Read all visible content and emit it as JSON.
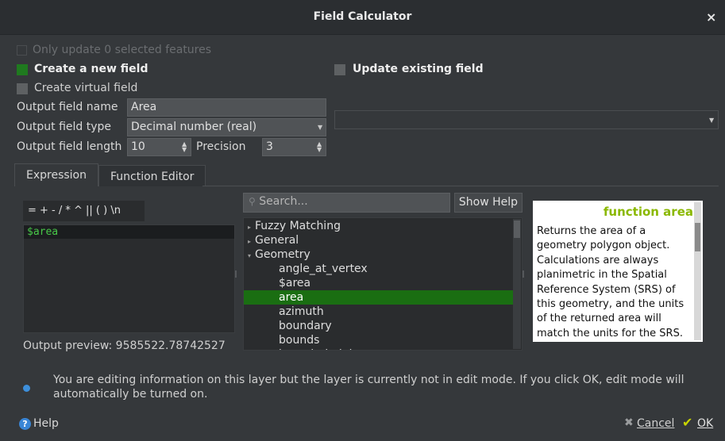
{
  "window": {
    "title": "Field Calculator",
    "close_glyph": "×"
  },
  "options": {
    "only_update_selected": "Only update 0 selected features",
    "create_new_field": "Create a new field",
    "update_existing_field": "Update existing field",
    "create_virtual_field": "Create virtual field"
  },
  "output": {
    "name_label": "Output field name",
    "name_value": "Area",
    "type_label": "Output field type",
    "type_value": "Decimal number (real)",
    "length_label": "Output field length",
    "length_value": "10",
    "precision_label": "Precision",
    "precision_value": "3"
  },
  "existing_field": {
    "selected": ""
  },
  "tabs": [
    {
      "label": "Expression"
    },
    {
      "label": "Function Editor"
    }
  ],
  "operators": "= + - / * ^ || ( ) \\n",
  "expression": "$area",
  "preview": {
    "label": "Output preview: 9585522.78742527"
  },
  "search": {
    "placeholder": "Search...",
    "show_help": "Show Help"
  },
  "tree": {
    "groups": [
      {
        "label": "Fuzzy Matching",
        "expanded": false
      },
      {
        "label": "General",
        "expanded": false
      },
      {
        "label": "Geometry",
        "expanded": true
      }
    ],
    "items": [
      "angle_at_vertex",
      "$area",
      "area",
      "azimuth",
      "boundary",
      "bounds",
      "bounds_height"
    ],
    "selected": "area"
  },
  "help": {
    "title": "function area",
    "lines": [
      "Returns the area of a",
      "geometry polygon object.",
      "Calculations are always",
      "planimetric in the Spatial",
      "Reference System (SRS) of",
      "this geometry, and the units",
      "of the returned area will",
      "match the units for the SRS."
    ]
  },
  "message": {
    "line1": "You are editing information on this layer but the layer is currently not in edit mode. If you click OK, edit mode will",
    "line2": "automatically be turned on."
  },
  "buttons": {
    "help": "Help",
    "cancel": "Cancel",
    "ok": "OK"
  },
  "colors": {
    "accent_green": "#1a6e12",
    "help_title": "#8ab800",
    "info_blue": "#3d8fdb"
  }
}
